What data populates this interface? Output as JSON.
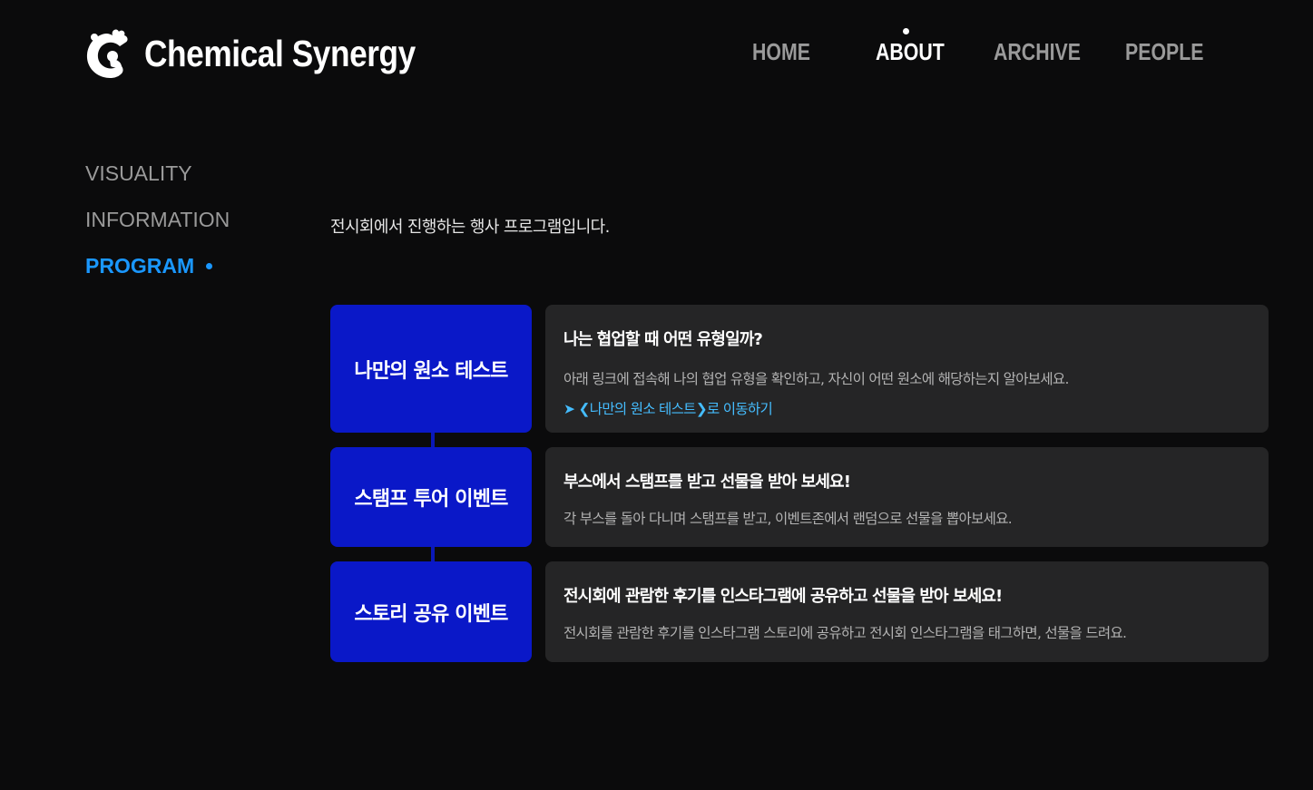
{
  "brand": {
    "name": "Chemical Synergy",
    "icon": "splash-c-logo-icon"
  },
  "nav": {
    "items": [
      {
        "label": "HOME",
        "active": false
      },
      {
        "label": "ABOUT",
        "active": true
      },
      {
        "label": "ARCHIVE",
        "active": false
      },
      {
        "label": "PEOPLE",
        "active": false
      }
    ]
  },
  "sidebar": {
    "items": [
      {
        "label": "VISUALITY",
        "active": false
      },
      {
        "label": "INFORMATION",
        "active": false
      },
      {
        "label": "PROGRAM",
        "active": true
      }
    ]
  },
  "main": {
    "intro": "전시회에서 진행하는 행사 프로그램입니다.",
    "programs": [
      {
        "label": "나만의 원소 테스트",
        "title": "나는 협업할 때 어떤 유형일까?",
        "description": "아래 링크에 접속해 나의 협업 유형을 확인하고, 자신이 어떤 원소에 해당하는지 알아보세요.",
        "link": "➤ ❮나만의 원소 테스트❯로 이동하기"
      },
      {
        "label": "스탬프 투어 이벤트",
        "title": "부스에서 스탬프를 받고 선물을 받아 보세요!",
        "description": "각 부스를 돌아 다니며 스탬프를 받고, 이벤트존에서 랜덤으로 선물을 뽑아보세요."
      },
      {
        "label": "스토리 공유 이벤트",
        "title": "전시회에 관람한 후기를 인스타그램에 공유하고 선물을 받아 보세요!",
        "description": "전시회를 관람한 후기를 인스타그램 스토리에 공유하고 전시회 인스타그램을 태그하면, 선물을 드려요."
      }
    ]
  },
  "colors": {
    "background": "#0b0b0c",
    "accent": "#1a97ff",
    "program_label": "#0a18c8",
    "card": "#252526",
    "link": "#45bdff"
  }
}
